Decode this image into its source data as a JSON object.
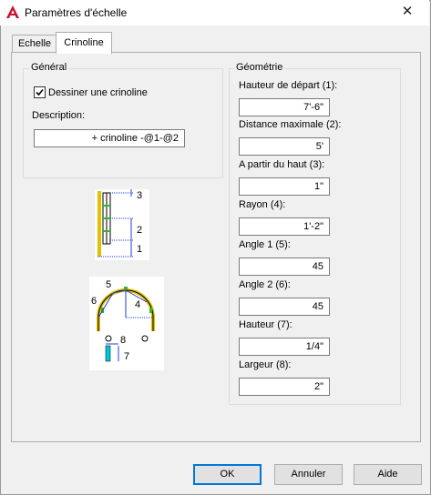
{
  "window": {
    "title": "Paramètres d'échelle",
    "app_icon": "autocad-a-icon",
    "close_glyph": "✕"
  },
  "tabs": [
    {
      "label": "Echelle",
      "active": false
    },
    {
      "label": "Crinoline",
      "active": true
    }
  ],
  "general": {
    "legend": "Général",
    "draw_checkbox": {
      "label": "Dessiner une crinoline",
      "checked": true
    },
    "description_label": "Description:",
    "description_value": "+ crinoline -@1-@2"
  },
  "geometry": {
    "legend": "Géométrie",
    "fields": [
      {
        "label": "Hauteur de départ (1):",
        "value": "7'-6\""
      },
      {
        "label": "Distance maximale (2):",
        "value": "5'"
      },
      {
        "label": "A partir du haut (3):",
        "value": "1\""
      },
      {
        "label": "Rayon (4):",
        "value": "1'-2\""
      },
      {
        "label": "Angle 1 (5):",
        "value": "45"
      },
      {
        "label": "Angle 2 (6):",
        "value": "45"
      },
      {
        "label": "Hauteur (7):",
        "value": "1/4\""
      },
      {
        "label": "Largeur (8):",
        "value": "2\""
      }
    ]
  },
  "diagrams": {
    "elevation_labels": [
      "3",
      "2",
      "1"
    ],
    "plan_labels": [
      "5",
      "6",
      "4"
    ],
    "section_labels": [
      "8",
      "7"
    ]
  },
  "buttons": {
    "ok": "OK",
    "cancel": "Annuler",
    "help": "Aide"
  },
  "colors": {
    "accent": "#0078d7",
    "icon_red": "#c8102e",
    "dim_blue": "#1f3fe0",
    "cage_yellow": "#e0c000",
    "cage_cyan": "#00c8d8",
    "cage_green": "#2eb82e"
  }
}
